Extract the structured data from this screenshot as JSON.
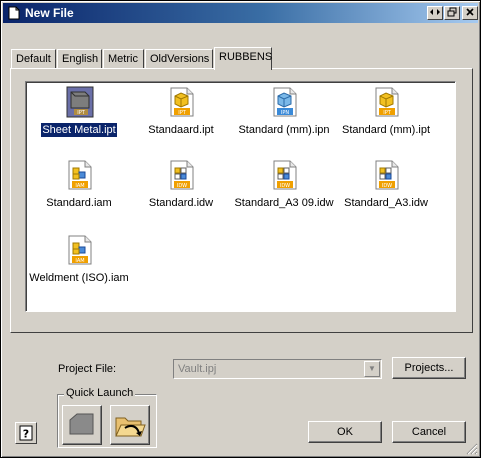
{
  "window": {
    "title": "New File"
  },
  "tabs": [
    {
      "label": "Default"
    },
    {
      "label": "English"
    },
    {
      "label": "Metric"
    },
    {
      "label": "OldVersions"
    },
    {
      "label": "RUBBENS"
    }
  ],
  "files": [
    {
      "name": "Sheet Metal.ipt",
      "type": "IPT",
      "icon": "sheet-metal-part-icon",
      "selected": true
    },
    {
      "name": "Standaard.ipt",
      "type": "IPT",
      "icon": "part-file-icon"
    },
    {
      "name": "Standard (mm).ipn",
      "type": "IPN",
      "icon": "presentation-file-icon"
    },
    {
      "name": "Standard (mm).ipt",
      "type": "IPT",
      "icon": "part-file-icon"
    },
    {
      "name": "Standard.iam",
      "type": "IAM",
      "icon": "assembly-file-icon"
    },
    {
      "name": "Standard.idw",
      "type": "IDW",
      "icon": "drawing-file-icon"
    },
    {
      "name": "Standard_A3 09.idw",
      "type": "IDW",
      "icon": "drawing-file-icon"
    },
    {
      "name": "Standard_A3.idw",
      "type": "IDW",
      "icon": "drawing-file-icon"
    },
    {
      "name": "Weldment (ISO).iam",
      "type": "IAM",
      "icon": "assembly-file-icon"
    }
  ],
  "project": {
    "label": "Project File:",
    "value": "Vault.ipj",
    "button": "Projects..."
  },
  "quick_launch": {
    "label": "Quick Launch",
    "buttons": [
      {
        "icon": "sheet-metal-launch-icon"
      },
      {
        "icon": "open-folder-icon"
      }
    ]
  },
  "buttons": {
    "ok": "OK",
    "cancel": "Cancel"
  },
  "colors": {
    "title_start": "#0a246a",
    "title_end": "#a6caf0",
    "selection": "#0a246a",
    "face": "#d4d0c8"
  }
}
